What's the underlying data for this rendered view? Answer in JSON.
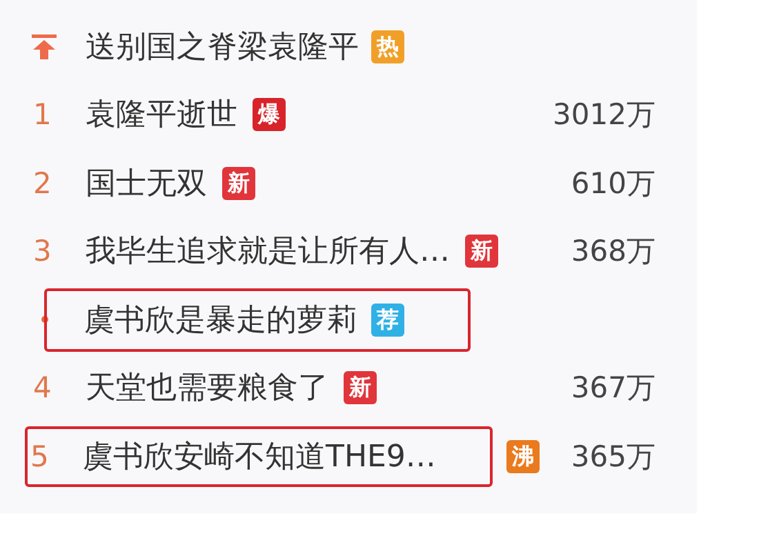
{
  "hot_list": [
    {
      "kind": "pinned",
      "title": "送别国之脊梁袁隆平",
      "badge": {
        "text": "热",
        "color": "#f0a028"
      },
      "highlighted": false
    },
    {
      "kind": "ranked",
      "rank": "1",
      "title": "袁隆平逝世",
      "badge": {
        "text": "爆",
        "color": "#d8232a"
      },
      "count": "3012万",
      "highlighted": false
    },
    {
      "kind": "ranked",
      "rank": "2",
      "title": "国士无双",
      "badge": {
        "text": "新",
        "color": "#e0353b"
      },
      "count": "610万",
      "highlighted": false
    },
    {
      "kind": "ranked",
      "rank": "3",
      "title": "我毕生追求就是让所有人…",
      "badge": {
        "text": "新",
        "color": "#e0353b"
      },
      "count": "368万",
      "highlighted": false
    },
    {
      "kind": "promoted",
      "title": "虞书欣是暴走的萝莉",
      "badge": {
        "text": "荐",
        "color": "#2fb1e6"
      },
      "highlighted": true
    },
    {
      "kind": "ranked",
      "rank": "4",
      "title": "天堂也需要粮食了",
      "badge": {
        "text": "新",
        "color": "#e0353b"
      },
      "count": "367万",
      "highlighted": false
    },
    {
      "kind": "ranked",
      "rank": "5",
      "title": "虞书欣安崎不知道THE9…",
      "badge": {
        "text": "沸",
        "color": "#ea7a1e"
      },
      "count": "365万",
      "highlighted": true
    }
  ]
}
